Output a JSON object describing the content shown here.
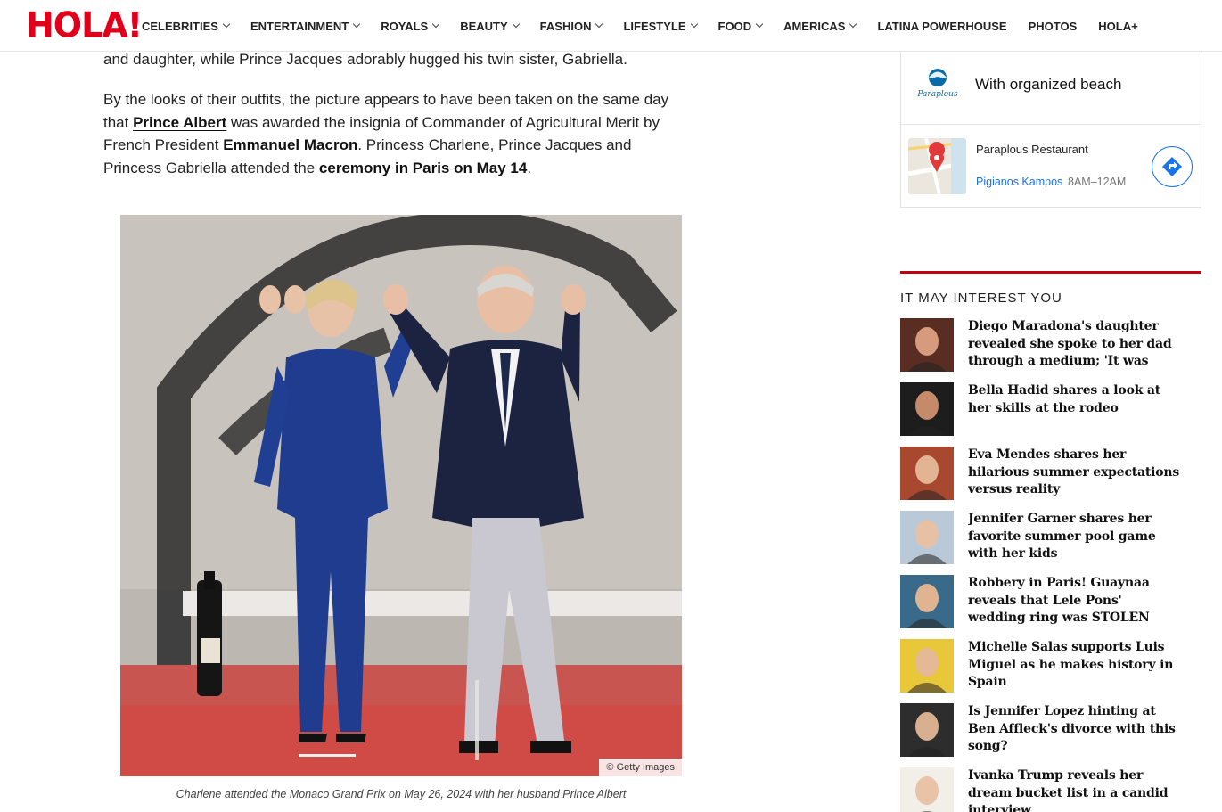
{
  "brand": {
    "logo_text": "HOLA!",
    "accent": "#e1001a"
  },
  "nav": {
    "items": [
      {
        "label": "CELEBRITIES",
        "dropdown": true
      },
      {
        "label": "ENTERTAINMENT",
        "dropdown": true
      },
      {
        "label": "ROYALS",
        "dropdown": true
      },
      {
        "label": "BEAUTY",
        "dropdown": true
      },
      {
        "label": "FASHION",
        "dropdown": true
      },
      {
        "label": "LIFESTYLE",
        "dropdown": true
      },
      {
        "label": "FOOD",
        "dropdown": true
      },
      {
        "label": "AMERICAS",
        "dropdown": true
      },
      {
        "label": "LATINA POWERHOUSE",
        "dropdown": false
      },
      {
        "label": "PHOTOS",
        "dropdown": false
      },
      {
        "label": "HOLA+",
        "dropdown": false
      }
    ]
  },
  "article": {
    "p1": "and daughter, while Prince Jacques adorably hugged his twin sister, Gabriella.",
    "p2": {
      "t1": "By the looks of their outfits, the picture appears to have been taken on the same day that ",
      "link1": "Prince Albert",
      "t2": " was awarded the insignia of Commander of Agricultural Merit by French President ",
      "bold1": "Emmanuel Macron",
      "t3": ". Princess Charlene, Prince Jacques and Princess Gabriella attended the",
      "link2": " ceremony in Paris on May 14",
      "t4": "."
    },
    "photo_credit": "© Getty Images",
    "caption": "Charlene attended the Monaco Grand Prix on May 26, 2024 with her husband Prince Albert"
  },
  "map_widget": {
    "logo_text": "Paraplous",
    "tagline": "With organized beach",
    "place_name": "Paraplous Restaurant",
    "location": "Pigianos Kampos",
    "hours": "8AM–12AM"
  },
  "sidebar": {
    "heading": "IT MAY INTEREST YOU",
    "items": [
      {
        "title": "Diego Maradona's daughter revealed she spoke to her dad through a medium; 'It was very…"
      },
      {
        "title": "Bella Hadid shares a look at her skills at the rodeo"
      },
      {
        "title": "Eva Mendes shares her hilarious summer expectations versus reality"
      },
      {
        "title": "Jennifer Garner shares her favorite summer pool game with her kids"
      },
      {
        "title": "Robbery in Paris! Guaynaa reveals that Lele Pons' wedding ring was STOLEN"
      },
      {
        "title": "Michelle Salas supports Luis Miguel as he makes history in Spain"
      },
      {
        "title": "Is Jennifer Lopez hinting at Ben Affleck's divorce with this song?"
      },
      {
        "title": "Ivanka Trump reveals her dream bucket list in a candid interview"
      }
    ]
  }
}
